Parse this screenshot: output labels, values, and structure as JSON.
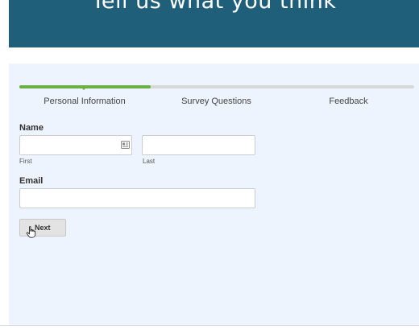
{
  "header": {
    "title": "Tell us what you think"
  },
  "progress": {
    "steps": [
      {
        "label": "Personal Information",
        "state": "active"
      },
      {
        "label": "Survey Questions",
        "state": "pending"
      },
      {
        "label": "Feedback",
        "state": "pending"
      }
    ],
    "active_step": 1,
    "fill_fraction": 0.333,
    "fill_color": "#6ab043",
    "track_color": "#d8d8d8"
  },
  "form": {
    "name_heading": "Name",
    "first": {
      "value": "",
      "placeholder": "",
      "sublabel": "First",
      "icon": "contact-card-icon"
    },
    "last": {
      "value": "",
      "placeholder": "",
      "sublabel": "Last"
    },
    "email_heading": "Email",
    "email": {
      "value": "",
      "placeholder": ""
    },
    "next_label": "Next"
  },
  "colors": {
    "header_background": "#1f5f7a",
    "panel_background": "#eef4fd"
  },
  "cursor": {
    "icon": "pointer-hand-icon"
  }
}
